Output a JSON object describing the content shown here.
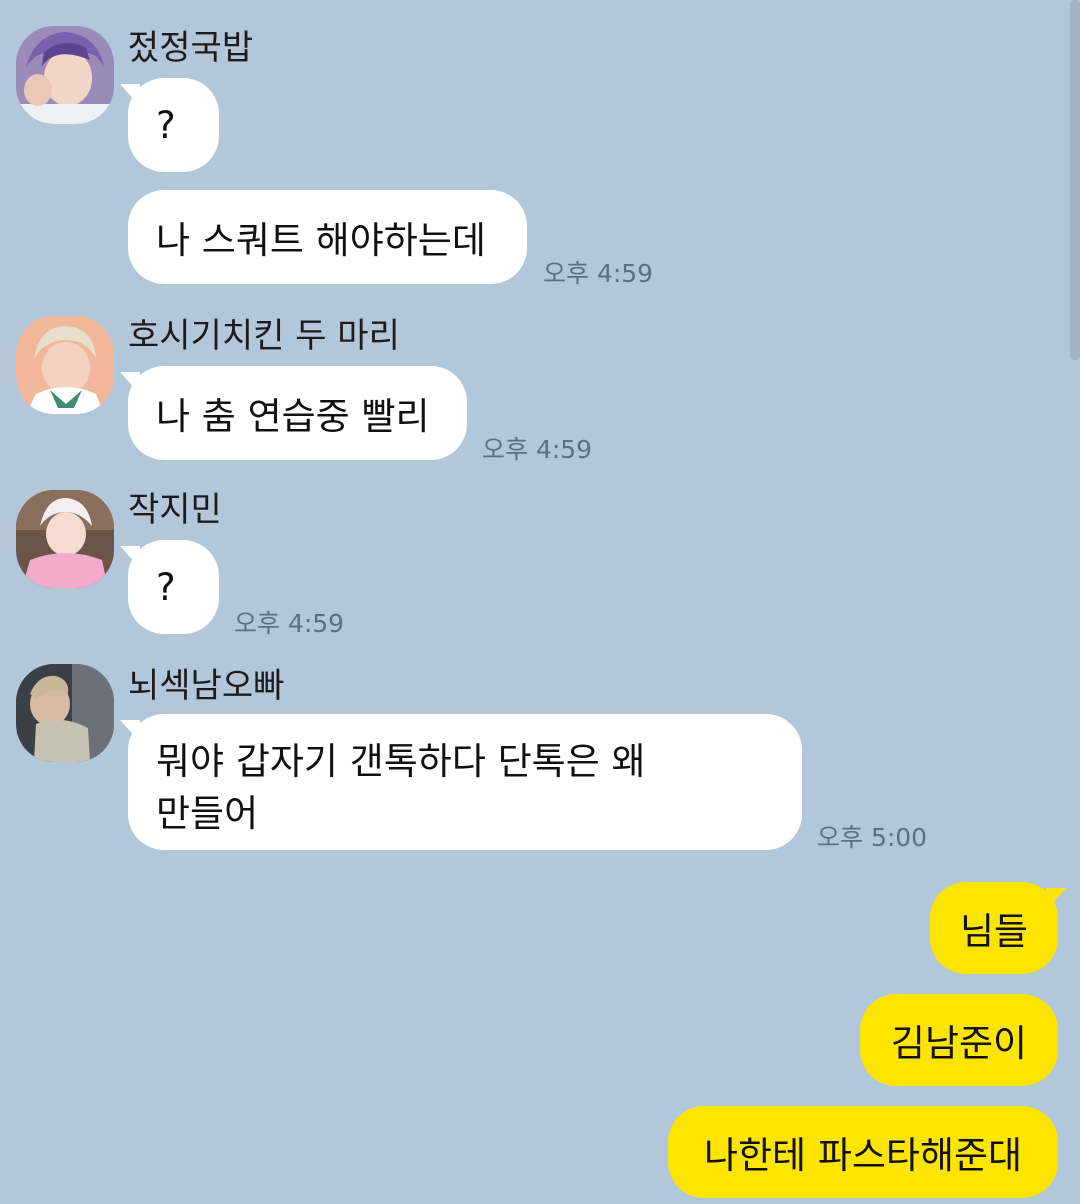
{
  "messages": {
    "m1": {
      "sender": "젔정국밥",
      "bubble1": "?",
      "bubble2": "나 스쿼트 해야하는데",
      "time": "오후 4:59"
    },
    "m2": {
      "sender": "호시기치킨 두 마리",
      "bubble1": "나 춤 연습중 빨리",
      "time": "오후 4:59"
    },
    "m3": {
      "sender": "작지민",
      "bubble1": "?",
      "time": "오후 4:59"
    },
    "m4": {
      "sender": "뇌섹남오빠",
      "bubble1_line1": "뭐야 갑자기 갠톡하다 단톡은 왜",
      "bubble1_line2": "만들어",
      "time": "오후 5:00"
    },
    "mine": [
      "님들",
      "김남준이",
      "나한테 파스타해준대"
    ]
  },
  "colors": {
    "background": "#b2c7da",
    "incoming_bubble": "#ffffff",
    "outgoing_bubble": "#fee500"
  },
  "icons": [
    "avatar-jungkook",
    "avatar-hoseok",
    "avatar-jimin",
    "avatar-namjoon"
  ]
}
